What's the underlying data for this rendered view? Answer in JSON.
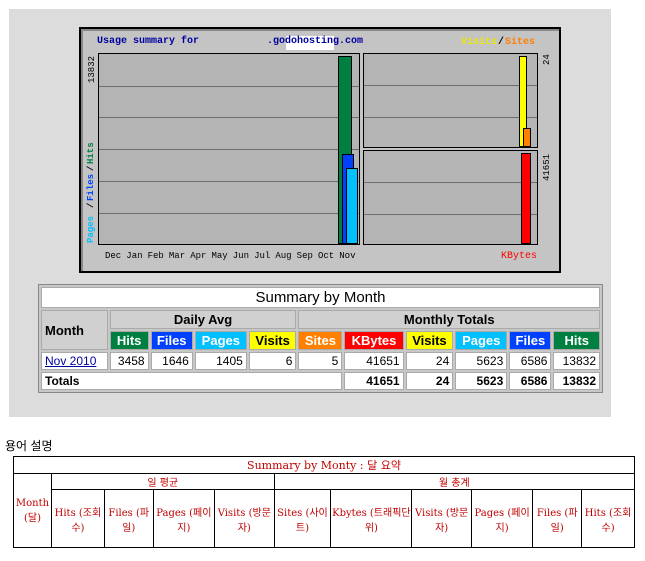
{
  "chart": {
    "title_prefix": "Usage summary for",
    "domain": ".godohosting.com",
    "legend_visits": "Visits",
    "legend_sep": "/",
    "legend_sites": "Sites",
    "left_max": "13832",
    "right_top_max": "24",
    "right_bottom_max": "41651",
    "left_axis_pages": "Pages",
    "left_axis_files": "Files",
    "left_axis_hits": "Hits",
    "kbytes_label": "KBytes",
    "months": [
      "Dec",
      "Jan",
      "Feb",
      "Mar",
      "Apr",
      "May",
      "Jun",
      "Jul",
      "Aug",
      "Sep",
      "Oct",
      "Nov"
    ],
    "colors": {
      "hits": "#008040",
      "files": "#0040ff",
      "pages": "#00c0ff",
      "visits": "#ffff00",
      "sites": "#ff8000",
      "kbytes": "#ff0000"
    }
  },
  "chart_data": {
    "type": "bar",
    "categories": [
      "Nov 2010"
    ],
    "series": [
      {
        "name": "Hits",
        "values": [
          13832
        ]
      },
      {
        "name": "Files",
        "values": [
          6586
        ]
      },
      {
        "name": "Pages",
        "values": [
          5623
        ]
      },
      {
        "name": "Visits",
        "values": [
          24
        ]
      },
      {
        "name": "Sites",
        "values": [
          5
        ]
      },
      {
        "name": "KBytes",
        "values": [
          41651
        ]
      }
    ]
  },
  "summary": {
    "title": "Summary by Month",
    "month_header": "Month",
    "daily_avg": "Daily Avg",
    "monthly_totals": "Monthly Totals",
    "daily_cols": [
      "Hits",
      "Files",
      "Pages",
      "Visits"
    ],
    "monthly_cols": [
      "Sites",
      "KBytes",
      "Visits",
      "Pages",
      "Files",
      "Hits"
    ],
    "row": {
      "month": "Nov 2010",
      "daily": [
        "3458",
        "1646",
        "1405",
        "6"
      ],
      "monthly": [
        "5",
        "41651",
        "24",
        "5623",
        "6586",
        "13832"
      ]
    },
    "totals_label": "Totals",
    "totals": [
      "41651",
      "24",
      "5623",
      "6586",
      "13832"
    ]
  },
  "glossary": {
    "section_label": "용어 설명",
    "title": "Summary by Monty : 달 요약",
    "daily": "일 평균",
    "monthly": "월 총계",
    "month": "Month (달)",
    "daily_cols": [
      "Hits (조회수)",
      "Files (파일)",
      "Pages (페이지)",
      "Visits (방문자)"
    ],
    "monthly_cols": [
      "Sites (사이트)",
      "Kbytes (트래픽단위)",
      "Visits (방문자)",
      "Pages (페이지)",
      "Files (파일)",
      "Hits (조회수)"
    ]
  }
}
